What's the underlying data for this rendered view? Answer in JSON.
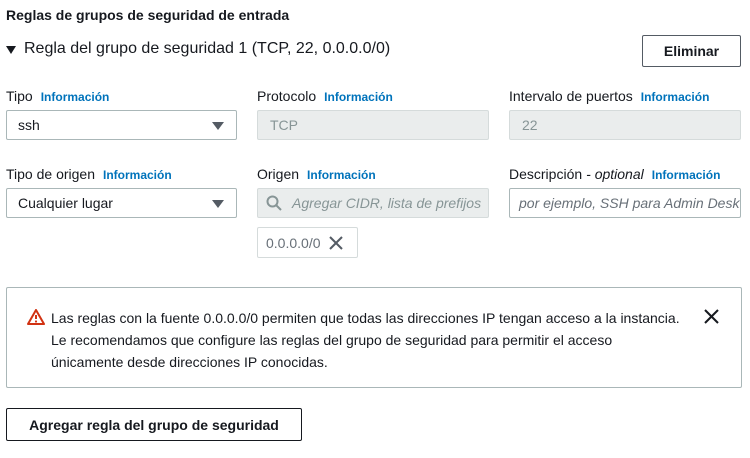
{
  "section": {
    "title": "Reglas de grupos de seguridad de entrada"
  },
  "rule": {
    "title": "Regla del grupo de seguridad 1 (TCP, 22, 0.0.0.0/0)",
    "delete_label": "Eliminar"
  },
  "info_label": "Información",
  "fields": {
    "tipo": {
      "label": "Tipo",
      "value": "ssh"
    },
    "protocolo": {
      "label": "Protocolo",
      "value": "TCP"
    },
    "intervalo": {
      "label": "Intervalo de puertos",
      "value": "22"
    },
    "tipo_origen": {
      "label": "Tipo de origen",
      "value": "Cualquier lugar"
    },
    "origen": {
      "label": "Origen",
      "placeholder": "Agregar CIDR, lista de prefijos",
      "token": "0.0.0.0/0"
    },
    "descripcion": {
      "label": "Descripción",
      "optional": "- optional",
      "placeholder": "por ejemplo, SSH para Admin Desk"
    }
  },
  "alert": {
    "line1": "Las reglas con la fuente 0.0.0.0/0 permiten que todas las direcciones IP tengan acceso a la instancia.",
    "line2": "Le recomendamos que configure las reglas del grupo de seguridad para permitir el acceso",
    "line3": "únicamente desde direcciones IP conocidas."
  },
  "add_rule_label": "Agregar regla del grupo de seguridad",
  "colors": {
    "info_link": "#0073bb",
    "warning": "#d13212",
    "disabled_bg": "#eaeded"
  },
  "icons": [
    "caret-down-icon",
    "dropdown-arrow-icon",
    "search-icon",
    "close-icon",
    "warning-icon"
  ]
}
